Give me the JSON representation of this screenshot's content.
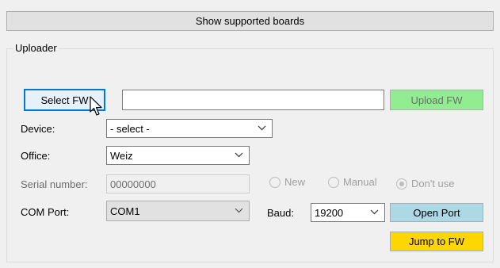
{
  "top_button": {
    "label": "Show supported boards"
  },
  "uploader": {
    "group_title": "Uploader",
    "select_fw_label": "Select FW",
    "fw_path_value": "",
    "upload_fw_label": "Upload FW",
    "device": {
      "label": "Device:",
      "value": "- select -"
    },
    "office": {
      "label": "Office:",
      "value": "Weiz"
    },
    "serial": {
      "label": "Serial number:",
      "value": "00000000",
      "options": [
        {
          "label": "New",
          "checked": false
        },
        {
          "label": "Manual",
          "checked": false
        },
        {
          "label": "Don't use",
          "checked": true
        }
      ]
    },
    "com_port": {
      "label": "COM Port:",
      "value": "COM1"
    },
    "baud": {
      "label": "Baud:",
      "value": "19200"
    },
    "open_port_label": "Open Port",
    "jump_to_fw_label": "Jump to FW"
  },
  "colors": {
    "upload_fw_bg": "#90ee90",
    "open_port_bg": "#add8e6",
    "jump_to_fw_bg": "#ffd700",
    "focus_border": "#0078d7"
  }
}
